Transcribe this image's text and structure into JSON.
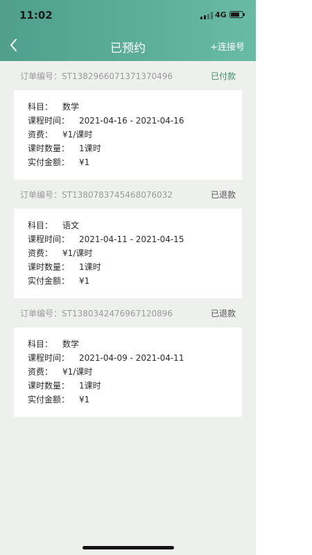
{
  "status_bar": {
    "time": "11:02",
    "network": "4G"
  },
  "nav": {
    "title": "已预约",
    "action": "+连接号",
    "back_icon": "chevron-left-icon"
  },
  "colors": {
    "header_start": "#4f9f8c",
    "header_end": "#69bba4",
    "paid_status": "#3b8a6e",
    "refunded_status": "#555555",
    "background": "#eef0ee"
  },
  "orders": [
    {
      "order_no": "订单编号：ST1382966071371370496",
      "status": "已付款",
      "subject_label": "科目：",
      "subject": "数学",
      "time_label": "课程时间：",
      "time": "2021-04-16 - 2021-04-16",
      "fee_label": "资费：",
      "fee": "¥1/课时",
      "count_label": "课时数量：",
      "count": "1课时",
      "paid_label": "实付金额：",
      "paid": "¥1"
    },
    {
      "order_no": "订单编号：ST1380783745468076032",
      "status": "已退款",
      "subject_label": "科目：",
      "subject": "语文",
      "time_label": "课程时间：",
      "time": "2021-04-11 - 2021-04-15",
      "fee_label": "资费：",
      "fee": "¥1/课时",
      "count_label": "课时数量：",
      "count": "1课时",
      "paid_label": "实付金额：",
      "paid": "¥1"
    },
    {
      "order_no": "订单编号：ST1380342476967120896",
      "status": "已退款",
      "subject_label": "科目：",
      "subject": "数学",
      "time_label": "课程时间：",
      "time": "2021-04-09 - 2021-04-11",
      "fee_label": "资费：",
      "fee": "¥1/课时",
      "count_label": "课时数量：",
      "count": "1课时",
      "paid_label": "实付金额：",
      "paid": "¥1"
    }
  ]
}
